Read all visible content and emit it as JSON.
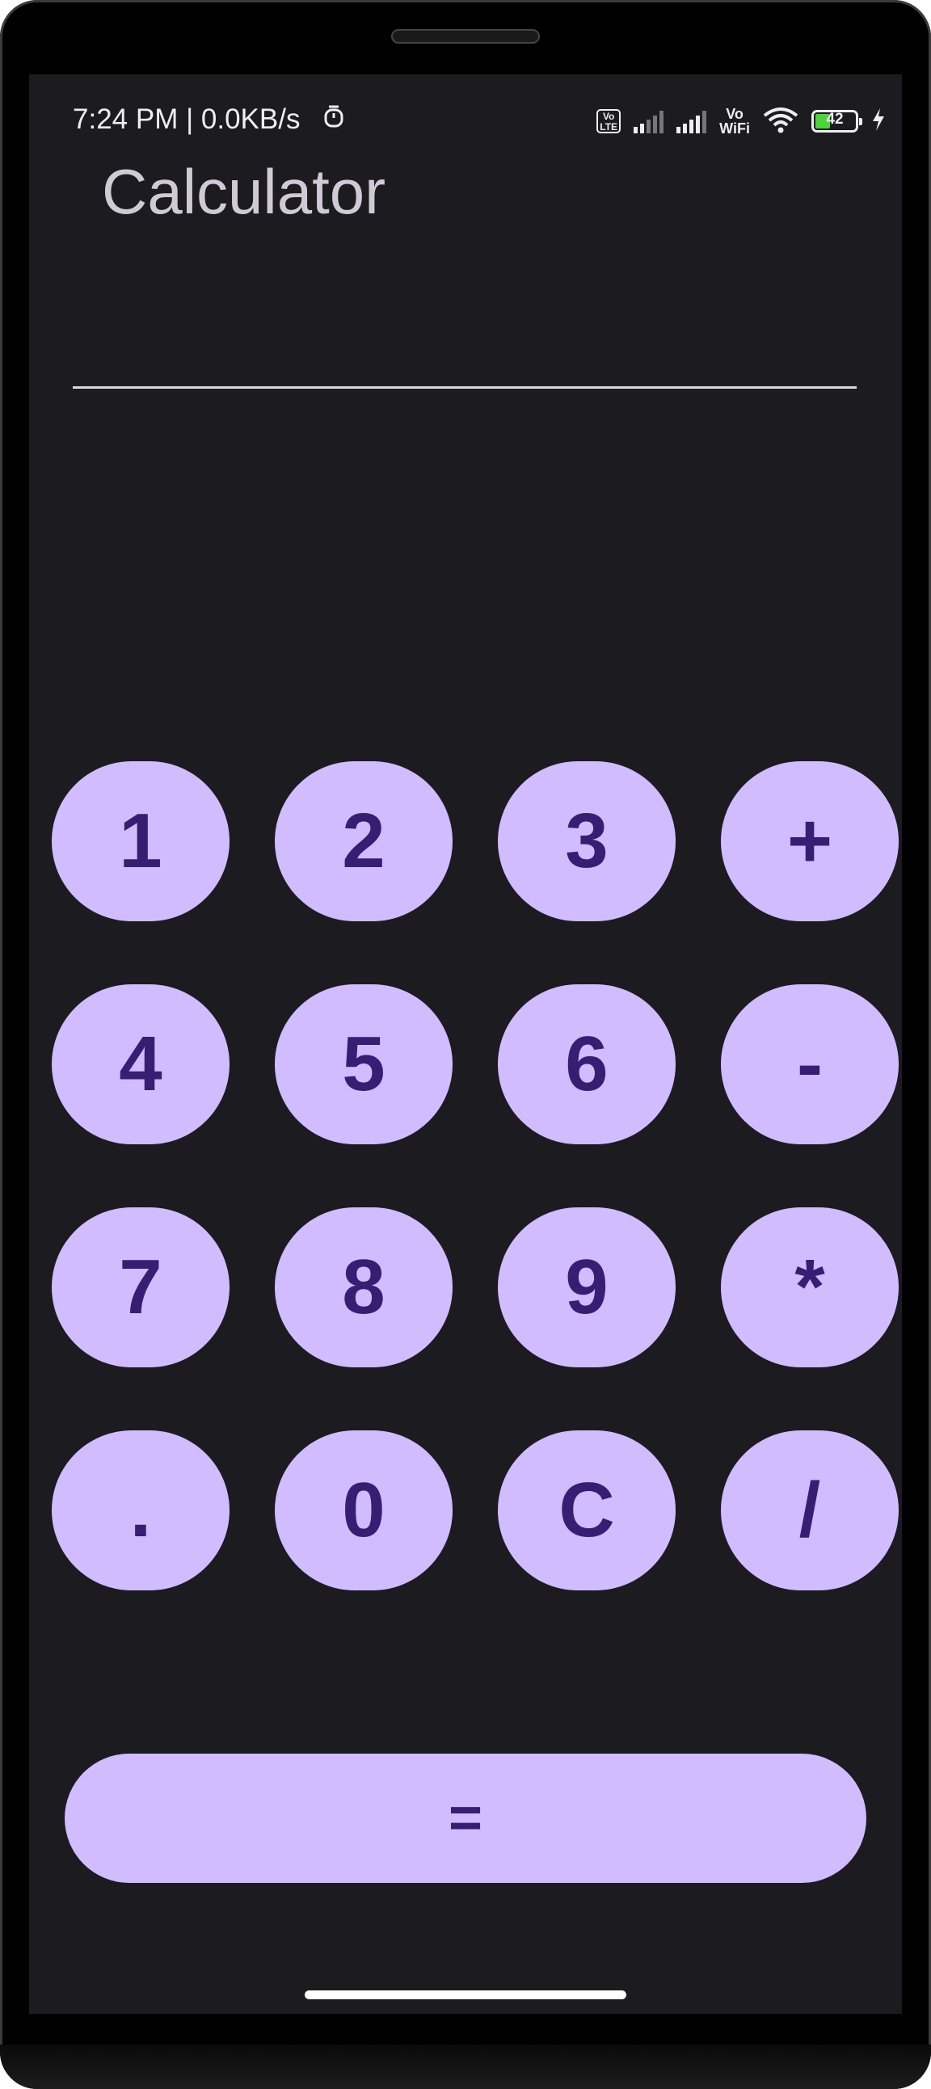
{
  "status_bar": {
    "time_speed": "7:24 PM | 0.0KB/s",
    "volte_label": "Vo LTE",
    "vowifi_label": "Vo WiFi",
    "battery_level": "42",
    "battery_color": "#4cd43a"
  },
  "app": {
    "title": "Calculator",
    "display_value": ""
  },
  "keypad": {
    "rows": [
      [
        "1",
        "2",
        "3",
        "+"
      ],
      [
        "4",
        "5",
        "6",
        "-"
      ],
      [
        "7",
        "8",
        "9",
        "*"
      ],
      [
        ".",
        "0",
        "C",
        "/"
      ]
    ],
    "equals_label": "="
  },
  "colors": {
    "background": "#1c1b1f",
    "button_fill": "#d0bcff",
    "button_text": "#381e72",
    "title_text": "#cfcbd4"
  },
  "icons": {
    "alarm": "alarm-icon",
    "signal": "signal-icon",
    "wifi": "wifi-icon",
    "battery": "battery-icon",
    "charging": "charging-bolt-icon"
  }
}
